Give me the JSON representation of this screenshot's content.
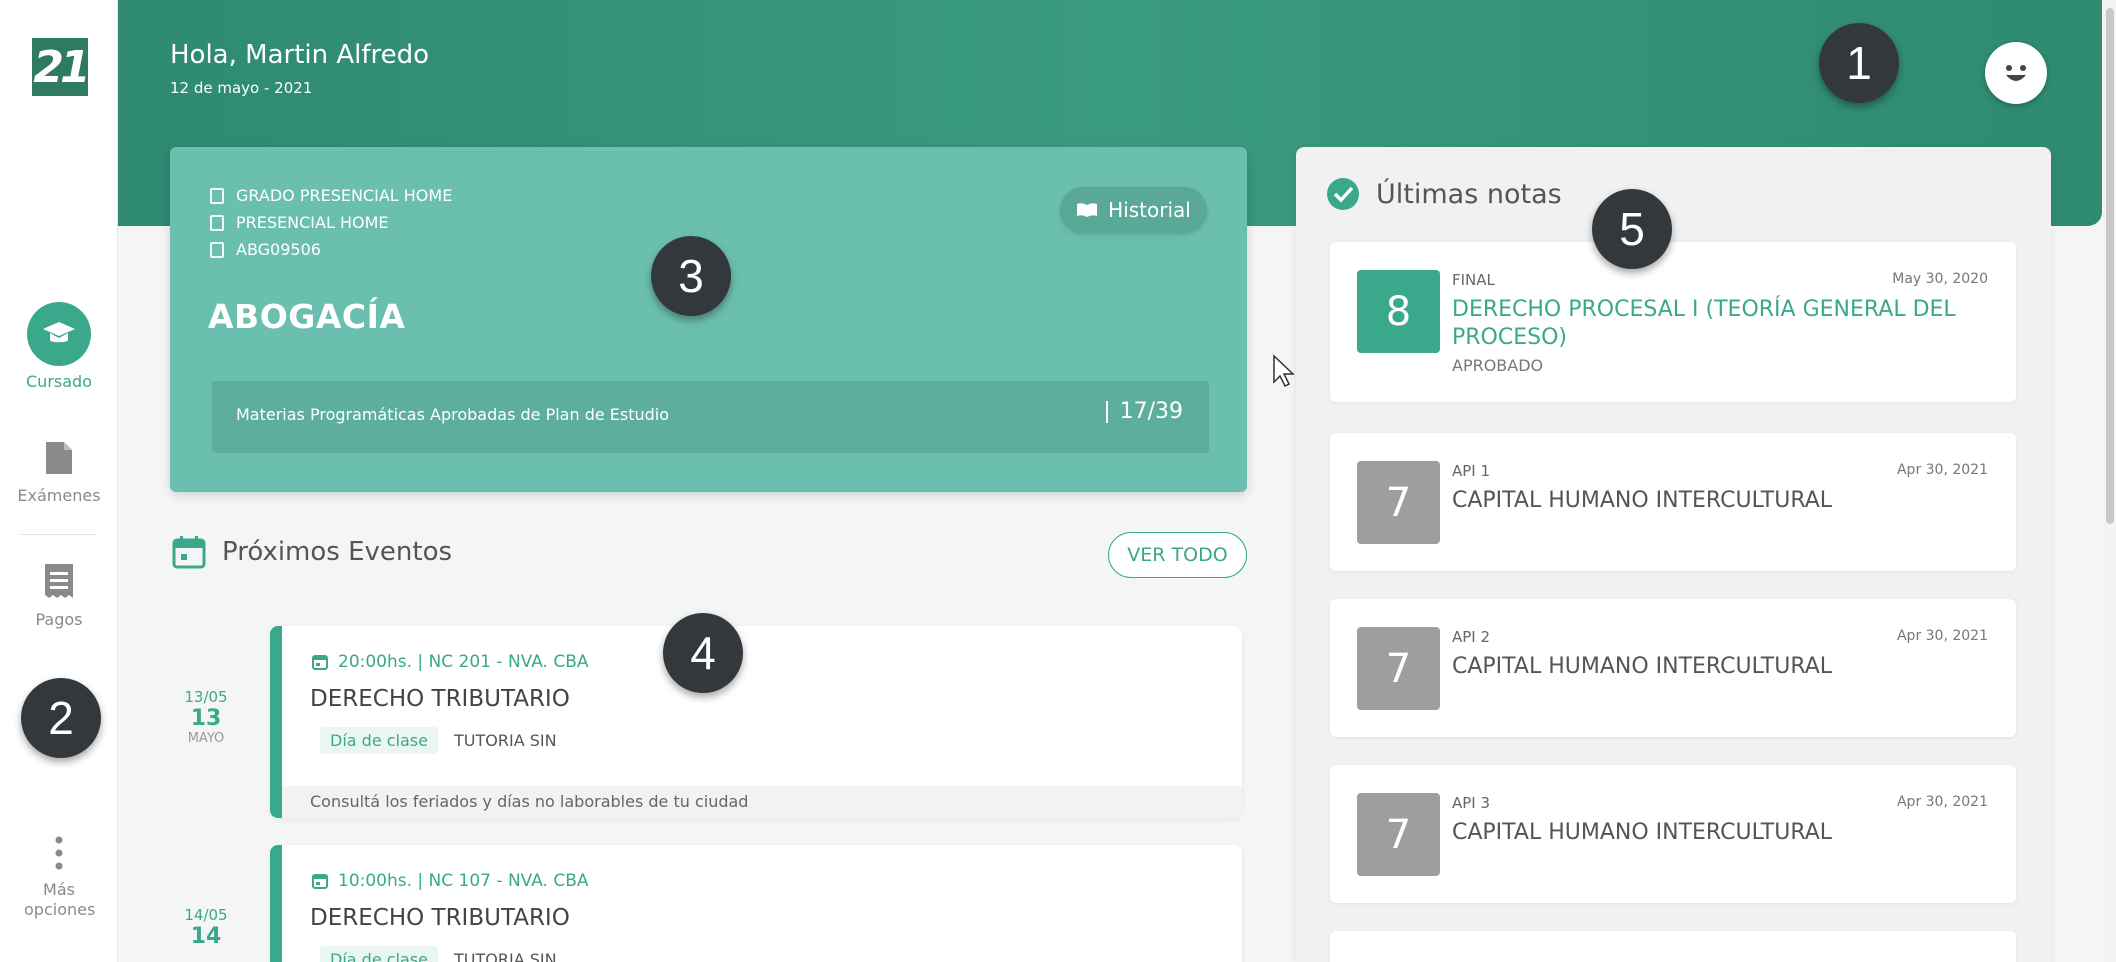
{
  "header": {
    "greeting": "Hola, Martin Alfredo",
    "date": "12 de mayo - 2021"
  },
  "logo_text": "21",
  "sidebar": {
    "items": [
      {
        "label": "Cursado",
        "icon": "graduation-cap-icon",
        "active": true
      },
      {
        "label": "Exámenes",
        "icon": "document-icon",
        "active": false
      },
      {
        "label": "Pagos",
        "icon": "receipt-icon",
        "active": false
      },
      {
        "label": "Más opciones",
        "icon": "more-vertical-icon",
        "active": false
      }
    ]
  },
  "badges": [
    "1",
    "2",
    "3",
    "4",
    "5"
  ],
  "career": {
    "modality": "GRADO PRESENCIAL HOME",
    "campus": "PRESENCIAL HOME",
    "code": "ABG09506",
    "title": "ABOGACÍA",
    "history_label": "Historial",
    "progress_label": "Materias Programáticas Aprobadas de Plan de Estudio",
    "progress_value": "17/39"
  },
  "events": {
    "title": "Próximos Eventos",
    "view_all": "VER TODO",
    "items": [
      {
        "date_short": "13/05",
        "day": "13",
        "month": "MAYO",
        "time_place": "20:00hs. | NC 201 - NVA. CBA",
        "name": "DERECHO TRIBUTARIO",
        "tag": "Día de clase",
        "tag2": "TUTORIA SIN",
        "footer": "Consultá los feriados y días no laborables de tu ciudad"
      },
      {
        "date_short": "14/05",
        "day": "14",
        "month": "",
        "time_place": "10:00hs. | NC 107 - NVA. CBA",
        "name": "DERECHO TRIBUTARIO",
        "tag": "Día de clase",
        "tag2": "TUTORIA SIN"
      }
    ]
  },
  "notes": {
    "title": "Últimas notas",
    "items": [
      {
        "grade": "8",
        "type": "FINAL",
        "date": "May 30, 2020",
        "subject": "DERECHO PROCESAL I (TEORÍA GENERAL DEL PROCESO)",
        "status": "APROBADO",
        "color": "#3aa88b"
      },
      {
        "grade": "7",
        "type": "API 1",
        "date": "Apr 30, 2021",
        "subject": "CAPITAL HUMANO INTERCULTURAL",
        "status": "",
        "color": "#9e9e9e"
      },
      {
        "grade": "7",
        "type": "API 2",
        "date": "Apr 30, 2021",
        "subject": "CAPITAL HUMANO INTERCULTURAL",
        "status": "",
        "color": "#9e9e9e"
      },
      {
        "grade": "7",
        "type": "API 3",
        "date": "Apr 30, 2021",
        "subject": "CAPITAL HUMANO INTERCULTURAL",
        "status": "",
        "color": "#9e9e9e"
      }
    ]
  },
  "colors": {
    "accent": "#3aa88b",
    "header": "#2e8a70",
    "card": "#6bbfae",
    "dark_badge": "#33383d"
  }
}
